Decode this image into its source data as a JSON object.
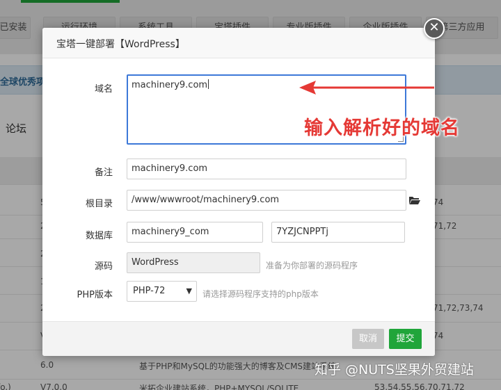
{
  "background": {
    "tabs": [
      "已安装",
      "运行环境",
      "系统工具",
      "宝塔插件",
      "专业版插件",
      "企业版插件",
      "第三方应用"
    ],
    "banner_text": "全球优秀项目",
    "forum_label": "论坛",
    "rows": [
      {
        "version": "5",
        "php": "74"
      },
      {
        "version": "2",
        "php": "71,72"
      },
      {
        "version": "2",
        "php": ""
      },
      {
        "version": "1",
        "php": ""
      },
      {
        "version": "2",
        "php": "71,72,73,74"
      },
      {
        "version": "V",
        "php": "74"
      },
      {
        "version": "6.0",
        "desc": "基于PHP和MySQL的功能强大的博客及CMS建站系统"
      },
      {
        "version": "V7.0.0",
        "desc": "米拓企业建站系统，PHP+MYSQL/SQLITE",
        "php": "53,54,55,56,70,71,72",
        "left": "fo.)"
      }
    ]
  },
  "dialog": {
    "title": "宝塔一键部署【WordPress】",
    "close_glyph": "✕",
    "domain_label": "域名",
    "domain_value": "machinery9.com",
    "remark_label": "备注",
    "remark_value": "machinery9.com",
    "root_label": "根目录",
    "root_value": "/www/wwwroot/machinery9.com",
    "db_label": "数据库",
    "db_name": "machinery9_com",
    "db_password": "7YZJCNPPTj",
    "source_label": "源码",
    "source_value": "WordPress",
    "source_hint": "准备为你部署的源码程序",
    "php_label": "PHP版本",
    "php_value": "PHP-72",
    "php_hint": "请选择源码程序支持的php版本",
    "cancel_label": "取消",
    "submit_label": "提交"
  },
  "annotation": {
    "text": "输入解析好的域名",
    "color": "#e53935"
  },
  "watermark": "知乎 @NUTS坚果外贸建站",
  "colors": {
    "accent_green": "#20a53a",
    "focus_blue": "#3c78d8"
  }
}
